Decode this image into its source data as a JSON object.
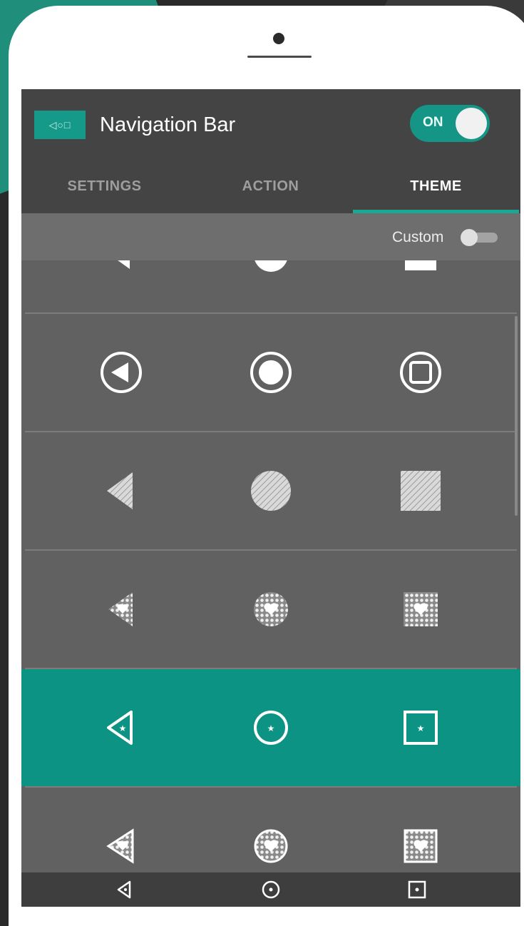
{
  "app": {
    "title": "Navigation Bar",
    "logo_glyphs": "◁○□",
    "master_toggle": {
      "label": "ON",
      "state": "on"
    }
  },
  "tabs": [
    {
      "label": "SETTINGS",
      "active": false
    },
    {
      "label": "ACTION",
      "active": false
    },
    {
      "label": "THEME",
      "active": true
    }
  ],
  "custom_toggle": {
    "label": "Custom",
    "state": "off"
  },
  "themes": [
    {
      "name": "solid-partial",
      "icons": [
        "back-triangle-icon",
        "home-circle-icon",
        "recent-square-icon"
      ],
      "selected": false
    },
    {
      "name": "outlined-circles",
      "icons": [
        "back-circled-icon",
        "home-circled-icon",
        "recent-circled-icon"
      ],
      "selected": false
    },
    {
      "name": "hatched",
      "icons": [
        "back-hatched-icon",
        "home-hatched-icon",
        "recent-hatched-icon"
      ],
      "selected": false
    },
    {
      "name": "dotted-hearts",
      "icons": [
        "back-heart-icon",
        "home-heart-icon",
        "recent-heart-icon"
      ],
      "selected": false
    },
    {
      "name": "outline-star",
      "icons": [
        "back-star-icon",
        "home-star-icon",
        "recent-star-icon"
      ],
      "selected": true
    },
    {
      "name": "framed-hearts",
      "icons": [
        "back-framed-heart-icon",
        "home-framed-heart-icon",
        "recent-framed-heart-icon"
      ],
      "selected": false
    }
  ],
  "system_nav": [
    "back-star-icon",
    "home-star-icon",
    "recent-star-icon"
  ],
  "colors": {
    "accent": "#159a8a",
    "appbar": "#444444",
    "list_bg": "#616161",
    "selected_row": "#0c9383"
  }
}
